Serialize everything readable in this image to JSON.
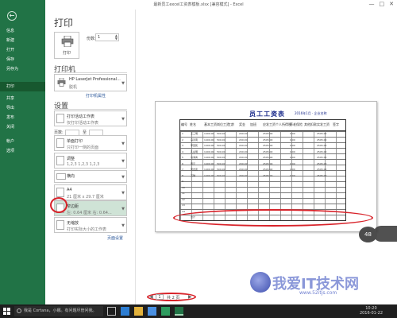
{
  "window": {
    "title": "最新员工excel工资表模板.xlsx [兼容模式] - Excel",
    "minimize": "—",
    "maximize": "□",
    "close": "✕"
  },
  "sidebar": {
    "back_icon": "back-arrow-icon",
    "items": [
      {
        "label": "信息"
      },
      {
        "label": "新建"
      },
      {
        "label": "打开"
      },
      {
        "label": "保存"
      },
      {
        "label": "另存为"
      },
      {
        "label": "打印",
        "active": true
      },
      {
        "label": "共享"
      },
      {
        "label": "导出"
      },
      {
        "label": "发布"
      },
      {
        "label": "关闭"
      },
      {
        "label": "帐户"
      },
      {
        "label": "选项"
      }
    ]
  },
  "print": {
    "heading": "打印",
    "button_label": "打印",
    "copies_label": "份数:",
    "copies_value": "1"
  },
  "printer": {
    "section_title": "打印机",
    "name": "HP LaserJet Professional...",
    "status": "脱机",
    "properties_link": "打印机属性"
  },
  "settings": {
    "section_title": "设置",
    "options": [
      {
        "line1": "打印活动工作表",
        "line2": "仅打印活动工作表"
      },
      {
        "line1": "单面打印",
        "line2": "只打印一侧的页面"
      },
      {
        "line1": "调整",
        "line2": "1,2,3    1,2,3    1,2,3"
      },
      {
        "line1": "横向",
        "line2": ""
      },
      {
        "line1": "A4",
        "line2": "21 厘米 x 29.7 厘米"
      },
      {
        "line1": "窄边距",
        "line2": "左: 0.64 厘米   右: 0.64..."
      },
      {
        "line1": "无缩放",
        "line2": "打印实际大小的工作表"
      }
    ],
    "pages_label": "页数:",
    "pages_to": "至",
    "page_setup_link": "页面设置"
  },
  "preview": {
    "sheet_title": "员工工资表",
    "sheet_subtitle": "2016年1月 · 企业名称",
    "headers": [
      "编号",
      "姓名",
      "基本工资",
      "岗位工资",
      "工龄",
      "奖金",
      "加班",
      "应发工资",
      "个人所得税",
      "养老保险",
      "其他扣款",
      "实发工资",
      "签字"
    ],
    "rows": [
      {
        "no": "1",
        "name": "王三明"
      },
      {
        "no": "2",
        "name": "马善南"
      },
      {
        "no": "3",
        "name": "李富民"
      },
      {
        "no": "4",
        "name": "孔总明"
      },
      {
        "no": "5",
        "name": "马海青"
      },
      {
        "no": "6",
        "name": "黄元"
      },
      {
        "no": "7",
        "name": "吴志武"
      },
      {
        "no": "8",
        "name": "万琪"
      },
      {
        "no": "9",
        "name": ""
      },
      {
        "no": "10",
        "name": ""
      },
      {
        "no": "11",
        "name": ""
      },
      {
        "no": "12",
        "name": ""
      },
      {
        "no": "13",
        "name": ""
      },
      {
        "no": "14",
        "name": ""
      },
      {
        "no": "",
        "name": "合计"
      }
    ],
    "sample_values": [
      "1400.00",
      "500.00",
      "200.00",
      "2505.00",
      "0.00",
      "2505.00"
    ]
  },
  "pager": {
    "prev": "◀",
    "current": "1",
    "total": "共 2 页",
    "next": "▶"
  },
  "zoom": {
    "badge": "48"
  },
  "watermark": {
    "text": "我爱IT技术网",
    "url": "www.52itjs.com"
  },
  "taskbar": {
    "search_placeholder": "我是 Cortana，小娜。有问题尽管问我。",
    "time": "10:20",
    "date": "2016-01-22"
  },
  "colors": {
    "sidebar": "#217346",
    "sidebar_active": "#17582f",
    "annotation": "#d8232a",
    "link": "#2b579a"
  }
}
